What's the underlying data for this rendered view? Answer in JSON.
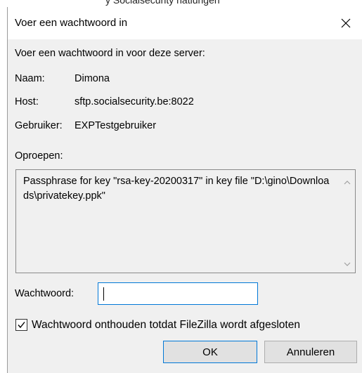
{
  "background_window": {
    "partial_text": "y Socialsecurity hatlungen"
  },
  "dialog": {
    "title": "Voer een wachtwoord in",
    "close_icon": "close-icon",
    "intro": "Voer een wachtwoord in voor deze server:",
    "fields": [
      {
        "label": "Naam:",
        "value": "Dimona"
      },
      {
        "label": "Host:",
        "value": "sftp.socialsecurity.be:8022"
      },
      {
        "label": "Gebruiker:",
        "value": "EXPTestgebruiker"
      }
    ],
    "prompt_label": "Oproepen:",
    "prompt_text": "Passphrase for key \"rsa-key-20200317\" in key file \"D:\\gino\\Downloads\\privatekey.ppk\"",
    "password_label": "Wachtwoord:",
    "password_value": "",
    "remember_label": "Wachtwoord onthouden totdat FileZilla wordt afgesloten",
    "remember_checked": true,
    "ok_label": "OK",
    "cancel_label": "Annuleren"
  },
  "colors": {
    "dialog_bg": "#f0f0f0",
    "titlebar_bg": "#ffffff",
    "focus_border": "#0078d7"
  }
}
